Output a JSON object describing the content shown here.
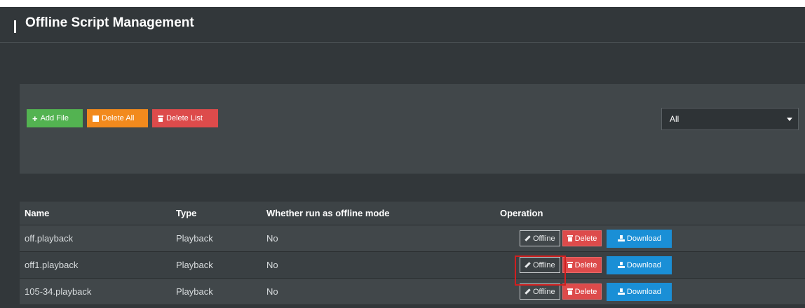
{
  "page": {
    "title": "Offline Script Management"
  },
  "toolbar": {
    "add_label": "Add File",
    "delete_all_label": "Delete All",
    "delete_list_label": "Delete List",
    "filter_value": "All"
  },
  "table": {
    "headers": [
      "Name",
      "Type",
      "Whether run as offline mode",
      "Operation"
    ],
    "rows": [
      {
        "name": "off.playback",
        "type": "Playback",
        "offline_mode": "No"
      },
      {
        "name": "off1.playback",
        "type": "Playback",
        "offline_mode": "No"
      },
      {
        "name": "105-34.playback",
        "type": "Playback",
        "offline_mode": "No"
      }
    ],
    "actions": {
      "offline": "Offline",
      "delete": "Delete",
      "download": "Download"
    }
  },
  "colors": {
    "background": "#32373a",
    "panel": "#41474a",
    "add": "#53b351",
    "delete_all": "#f28a1d",
    "delete": "#dd4b4b",
    "download": "#1a8fd6",
    "highlight": "#d01f1f"
  },
  "icons": {
    "add": "plus-icon",
    "delete_all": "square-icon",
    "delete": "trash-icon",
    "offline": "pencil-icon",
    "download": "download-icon",
    "select": "caret-down-icon"
  }
}
